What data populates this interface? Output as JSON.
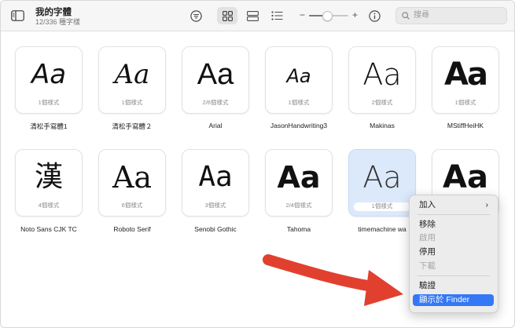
{
  "header": {
    "title": "我的字體",
    "subtitle": "12/336 種字樣"
  },
  "toolbar": {
    "zoom_level": 0.45
  },
  "search": {
    "placeholder": "搜尋"
  },
  "fonts": [
    {
      "name": "清松手寫體1",
      "sample": "Aa",
      "styles": "1個樣式"
    },
    {
      "name": "清松手寫體２",
      "sample": "Aa",
      "styles": "1個樣式"
    },
    {
      "name": "Arial",
      "sample": "Aa",
      "styles": "2/6個樣式"
    },
    {
      "name": "JasonHandwriting3",
      "sample": "Aa",
      "styles": "1個樣式"
    },
    {
      "name": "Makinas",
      "sample": "Aa",
      "styles": "2個樣式"
    },
    {
      "name": "MStiffHeiHK",
      "sample": "Aa",
      "styles": "1個樣式"
    },
    {
      "name": "Noto Sans CJK TC",
      "sample": "漢",
      "styles": "4個樣式"
    },
    {
      "name": "Roboto Serif",
      "sample": "Aa",
      "styles": "6個樣式"
    },
    {
      "name": "Senobi Gothic",
      "sample": "Aa",
      "styles": "3個樣式"
    },
    {
      "name": "Tahoma",
      "sample": "Aa",
      "styles": "2/4個樣式"
    },
    {
      "name": "timemachine wa",
      "sample": "Aa",
      "styles": "1個樣式"
    },
    {
      "name": "",
      "sample": "Aa",
      "styles": ""
    }
  ],
  "context_menu": {
    "add": "加入",
    "remove": "移除",
    "enable": "啟用",
    "disable": "停用",
    "download": "下載",
    "validate": "驗證",
    "show_in_finder": "顯示於 Finder"
  },
  "colors": {
    "accent": "#3478f6",
    "selected_card": "#dce9fb",
    "annotation_arrow": "#e2402f"
  }
}
